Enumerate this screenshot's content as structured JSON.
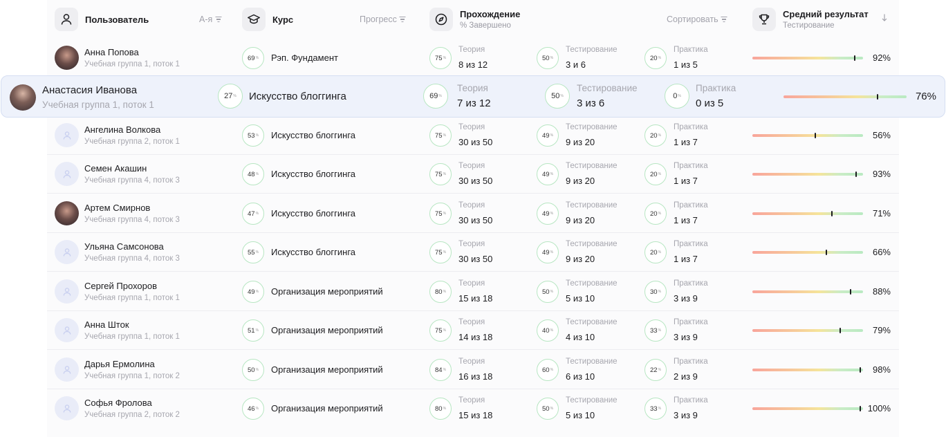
{
  "header": {
    "user_title": "Пользователь",
    "user_sort": "А-я",
    "course_title": "Курс",
    "course_sort": "Прогресс",
    "passing_title": "Прохождение",
    "passing_sub": "% Завершено",
    "passing_sort": "Сортировать",
    "result_title": "Средний результат",
    "result_sub": "Тестирование",
    "result_sort_icon": "arrow-down-icon"
  },
  "stage_labels": {
    "theory": "Теория",
    "testing": "Тестирование",
    "practice": "Практика"
  },
  "colors": {
    "ring_border": "#b7e6c2",
    "highlight_bg": "#eef2fb",
    "bar_red": "#f8a59b",
    "bar_yellow": "#f5e49a",
    "bar_green": "#b9eac2"
  },
  "rows": [
    {
      "name": "Анна  Попова",
      "group": "Учебная группа 1, поток 1",
      "avatar": "photo",
      "course_pct": "69",
      "course": "Рэп. Фундамент",
      "theory_pct": "75",
      "theory": "8 из 12",
      "testing_pct": "50",
      "testing": "3 и 6",
      "practice_pct": "20",
      "practice": "1 из 5",
      "result": 0.92,
      "result_label": "92%"
    },
    {
      "name": "Анастасия Иванова",
      "group": "Учебная группа 1, поток 1",
      "avatar": "photo2",
      "course_pct": "27",
      "course": "Искусство блоггинга",
      "theory_pct": "69",
      "theory": "7 из 12",
      "testing_pct": "50",
      "testing": "3 из 6",
      "practice_pct": "0",
      "practice": "0 из 5",
      "result": 0.76,
      "result_label": "76%",
      "highlighted": true
    },
    {
      "name": "Ангелина Волкова",
      "group": "Учебная группа 2, поток 1",
      "avatar": "placeholder",
      "course_pct": "53",
      "course": "Искусство блоггинга",
      "theory_pct": "75",
      "theory": "30 из 50",
      "testing_pct": "49",
      "testing": "9 из 20",
      "practice_pct": "20",
      "practice": "1 из 7",
      "result": 0.56,
      "result_label": "56%"
    },
    {
      "name": "Семен Акашин",
      "group": "Учебная группа 4, поток 3",
      "avatar": "placeholder",
      "course_pct": "48",
      "course": "Искусство блоггинга",
      "theory_pct": "75",
      "theory": "30 из 50",
      "testing_pct": "49",
      "testing": "9 из 20",
      "practice_pct": "20",
      "practice": "1 из 7",
      "result": 0.93,
      "result_label": "93%"
    },
    {
      "name": "Артем Смирнов",
      "group": "Учебная группа 4, поток 3",
      "avatar": "photo",
      "course_pct": "47",
      "course": "Искусство блоггинга",
      "theory_pct": "75",
      "theory": "30 из 50",
      "testing_pct": "49",
      "testing": "9 из 20",
      "practice_pct": "20",
      "practice": "1 из 7",
      "result": 0.71,
      "result_label": "71%"
    },
    {
      "name": "Ульяна Самсонова",
      "group": "Учебная группа 4, поток 3",
      "avatar": "placeholder",
      "course_pct": "55",
      "course": "Искусство блоггинга",
      "theory_pct": "75",
      "theory": "30 из 50",
      "testing_pct": "49",
      "testing": "9 из 20",
      "practice_pct": "20",
      "practice": "1 из 7",
      "result": 0.66,
      "result_label": "66%"
    },
    {
      "name": "Сергей Прохоров",
      "group": "Учебная группа 1, поток 1",
      "avatar": "placeholder",
      "course_pct": "49",
      "course": "Организация мероприятий",
      "theory_pct": "80",
      "theory": "15 из 18",
      "testing_pct": "50",
      "testing": "5 из 10",
      "practice_pct": "30",
      "practice": "3 из 9",
      "result": 0.88,
      "result_label": "88%"
    },
    {
      "name": "Анна Шток",
      "group": "Учебная группа 1, поток 1",
      "avatar": "placeholder",
      "course_pct": "51",
      "course": "Организация мероприятий",
      "theory_pct": "75",
      "theory": "14 из 18",
      "testing_pct": "40",
      "testing": "4 из 10",
      "practice_pct": "33",
      "practice": "3 из 9",
      "result": 0.79,
      "result_label": "79%"
    },
    {
      "name": "Дарья Ермолина",
      "group": "Учебная группа 1, поток 2",
      "avatar": "placeholder",
      "course_pct": "50",
      "course": "Организация мероприятий",
      "theory_pct": "84",
      "theory": "16 из 18",
      "testing_pct": "60",
      "testing": "6 из 10",
      "practice_pct": "22",
      "practice": "2 из 9",
      "result": 0.98,
      "result_label": "98%"
    },
    {
      "name": "Софья Фролова",
      "group": "Учебная группа 2, поток 2",
      "avatar": "placeholder",
      "course_pct": "46",
      "course": "Организация мероприятий",
      "theory_pct": "80",
      "theory": "15 из 18",
      "testing_pct": "50",
      "testing": "5 из 10",
      "practice_pct": "33",
      "practice": "3 из 9",
      "result": 1.0,
      "result_label": "100%"
    }
  ]
}
